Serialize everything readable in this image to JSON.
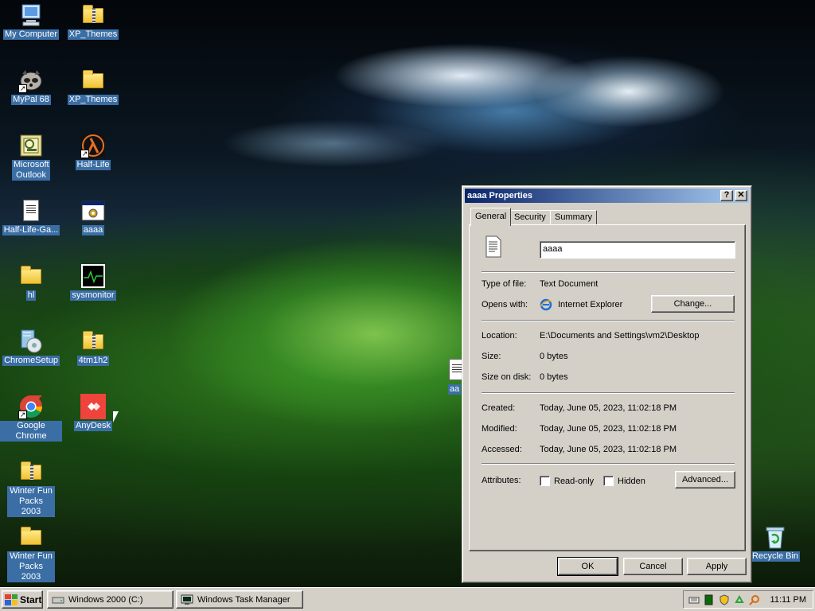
{
  "desktop": {
    "icons": [
      {
        "label": "My Computer",
        "icon": "computer-icon"
      },
      {
        "label": "XP_Themes",
        "icon": "zip-folder-icon"
      },
      {
        "label": "MyPal 68",
        "icon": "mypal-raccoon-icon"
      },
      {
        "label": "XP_Themes",
        "icon": "folder-icon"
      },
      {
        "label": "Microsoft Outlook",
        "icon": "outlook-icon"
      },
      {
        "label": "Half-Life",
        "icon": "half-life-lambda-icon"
      },
      {
        "label": "Half-Life-Ga...",
        "icon": "text-document-icon"
      },
      {
        "label": "aaaa",
        "icon": "app-window-icon"
      },
      {
        "label": "hl",
        "icon": "folder-icon"
      },
      {
        "label": "sysmonitor",
        "icon": "sysmonitor-icon"
      },
      {
        "label": "ChromeSetup",
        "icon": "installer-icon"
      },
      {
        "label": "4tm1h2",
        "icon": "zip-folder-icon"
      },
      {
        "label": "Google Chrome",
        "icon": "chrome-icon"
      },
      {
        "label": "AnyDesk",
        "icon": "anydesk-icon"
      },
      {
        "label": "Winter Fun Packs 2003",
        "icon": "zip-folder-icon"
      },
      {
        "label": "Winter Fun Packs 2003",
        "icon": "folder-icon"
      },
      {
        "label": "Recycle Bin",
        "icon": "recycle-bin-icon"
      },
      {
        "label": "aa",
        "icon": "text-document-icon"
      }
    ]
  },
  "dialog": {
    "title": "aaaa Properties",
    "help_btn": "?",
    "close_btn": "✕",
    "tabs": [
      "General",
      "Security",
      "Summary"
    ],
    "filename": "aaaa",
    "type_label": "Type of file:",
    "type_value": "Text Document",
    "opens_label": "Opens with:",
    "opens_value": "Internet Explorer",
    "change_btn": "Change...",
    "location_label": "Location:",
    "location_value": "E:\\Documents and Settings\\vm2\\Desktop",
    "size_label": "Size:",
    "size_value": "0 bytes",
    "sizeondisk_label": "Size on disk:",
    "sizeondisk_value": "0 bytes",
    "created_label": "Created:",
    "created_value": "Today, June 05, 2023, 11:02:18 PM",
    "modified_label": "Modified:",
    "modified_value": "Today, June 05, 2023, 11:02:18 PM",
    "accessed_label": "Accessed:",
    "accessed_value": "Today, June 05, 2023, 11:02:18 PM",
    "attributes_label": "Attributes:",
    "readonly_label": "Read-only",
    "hidden_label": "Hidden",
    "advanced_btn": "Advanced...",
    "ok_btn": "OK",
    "cancel_btn": "Cancel",
    "apply_btn": "Apply"
  },
  "taskbar": {
    "start_label": "Start",
    "tasks": [
      "Windows 2000 (C:)",
      "Windows Task Manager"
    ],
    "clock": "11:11 PM"
  },
  "colors": {
    "titlebar": "#0a246a",
    "selection": "#3a6ea5",
    "face": "#d4d0c8"
  }
}
